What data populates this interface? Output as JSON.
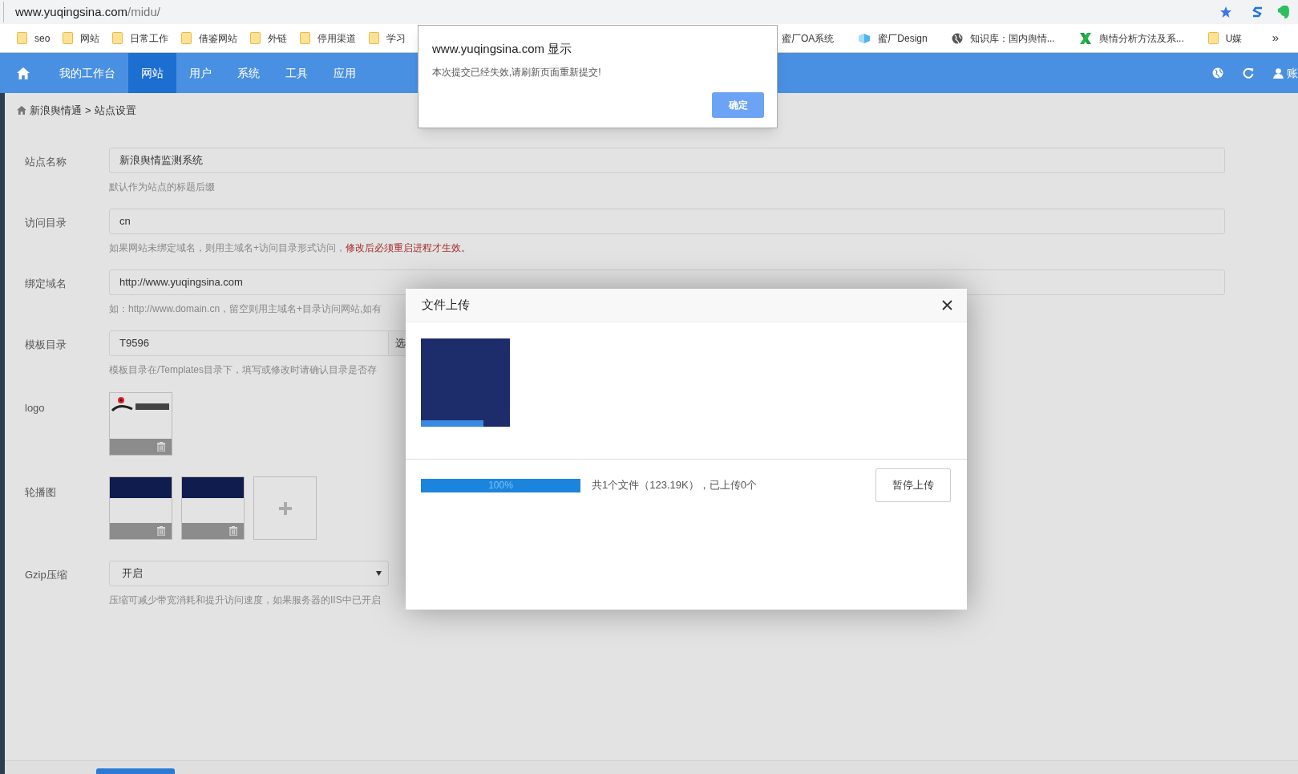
{
  "browser": {
    "url_host": "www.yuqingsina.com",
    "url_path": "/midu/",
    "bookmarks_left": [
      {
        "kind": "folder",
        "label": "seo"
      },
      {
        "kind": "folder",
        "label": "网站"
      },
      {
        "kind": "folder",
        "label": "日常工作"
      },
      {
        "kind": "folder",
        "label": "借鉴网站"
      },
      {
        "kind": "folder",
        "label": "外链"
      },
      {
        "kind": "folder",
        "label": "停用渠道"
      },
      {
        "kind": "folder",
        "label": "学习"
      }
    ],
    "bookmarks_right": [
      {
        "kind": "plain",
        "label": "蜜厂OA系统"
      },
      {
        "kind": "cube",
        "label": "蜜厂Design"
      },
      {
        "kind": "globe",
        "label": "知识库：国内舆情..."
      },
      {
        "kind": "x",
        "label": "舆情分析方法及系..."
      },
      {
        "kind": "folder",
        "label": "U媒"
      }
    ],
    "overflow": "»"
  },
  "nav": {
    "items": [
      {
        "label": "我的工作台",
        "selected": false
      },
      {
        "label": "网站",
        "selected": true
      },
      {
        "label": "用户",
        "selected": false
      },
      {
        "label": "系统",
        "selected": false
      },
      {
        "label": "工具",
        "selected": false
      },
      {
        "label": "应用",
        "selected": false
      }
    ],
    "account": "账"
  },
  "breadcrumb": {
    "items": [
      "新浪舆情通",
      "站点设置"
    ],
    "separator": ">"
  },
  "form": {
    "rows": [
      {
        "kind": "text",
        "label": "站点名称",
        "value": "新浪舆情监测系统",
        "hint": "默认作为站点的标题后缀"
      },
      {
        "kind": "text",
        "label": "访问目录",
        "value": "cn",
        "hint": "如果网站未绑定域名，则用主域名+访问目录形式访问，",
        "warning": "修改后必须重启进程才生效。"
      },
      {
        "kind": "text",
        "label": "绑定域名",
        "value": "http://www.yuqingsina.com",
        "hint": "如：http://www.domain.cn，留空则用主域名+目录访问网站,如有"
      },
      {
        "kind": "picker",
        "label": "模板目录",
        "value": "T9596",
        "button": "选",
        "hint": "模板目录在/Templates目录下，填写或修改时请确认目录是否存"
      },
      {
        "kind": "images",
        "label": "logo",
        "images": [
          {
            "kind": "logo"
          }
        ]
      },
      {
        "kind": "images",
        "label": "轮播图",
        "images": [
          {
            "kind": "banner"
          },
          {
            "kind": "banner"
          },
          {
            "kind": "add"
          }
        ]
      },
      {
        "kind": "select",
        "label": "Gzip压缩",
        "value": "开启",
        "hint": "压缩可减少带宽消耗和提升访问速度，如果服务器的IIS中已开启"
      }
    ]
  },
  "alert": {
    "title": "www.yuqingsina.com 显示",
    "message": "本次提交已经失效,请刷新页面重新提交!",
    "button": "确定"
  },
  "upload_dialog": {
    "title": "文件上传",
    "progress": {
      "level": 1,
      "label": "100%"
    },
    "status": "共1个文件（123.19K），已上传0个",
    "button": "暂停上传"
  }
}
